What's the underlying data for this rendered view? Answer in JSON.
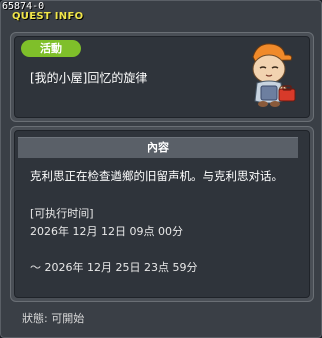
{
  "window": {
    "quest_id": "65874-0",
    "title": "QUEST INFO",
    "close_icon": "close-icon"
  },
  "quest": {
    "category": "活動",
    "name": "[我的小屋]回忆的旋律",
    "npc_icon": "npc-kid-with-cap-icon"
  },
  "content": {
    "header": "內容",
    "description": "克利思正在检查遒鄉的旧留声机。与克利思对话。",
    "time_label": "[可执行时间]",
    "time_start": "2026年 12月 12日 09点 00分",
    "time_end": "～ 2026年 12月 25日 23点 59分"
  },
  "status": {
    "text": "狀態: 可開始"
  },
  "colors": {
    "title": "#f1e64a",
    "badge": "#7fbf2a",
    "panel": "#2f343b"
  }
}
